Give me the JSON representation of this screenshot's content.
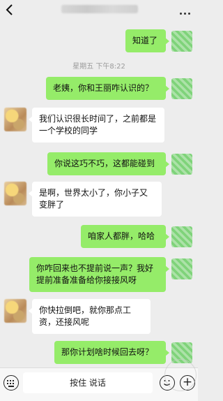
{
  "timestamp": "星期五 下午8:22",
  "messages": [
    {
      "dir": "out",
      "text": "知道了"
    },
    {
      "dir": "out",
      "text": "老姨，你和王丽咋认识的？"
    },
    {
      "dir": "in",
      "text": "我们认识很长时间了，之前都是一个学校的同学"
    },
    {
      "dir": "out",
      "text": "你说这巧不巧，这都能碰到"
    },
    {
      "dir": "in",
      "text": "是啊，世界太小了，你小子又变胖了"
    },
    {
      "dir": "out",
      "text": "咱家人都胖，哈哈"
    },
    {
      "dir": "out",
      "text": "你咋回来也不提前说一声？我好提前准备准备给你接接风呀"
    },
    {
      "dir": "in",
      "text": "你快拉倒吧，就你那点工资，还接风呢"
    },
    {
      "dir": "out",
      "text": "那你计划啥时候回去呀？"
    }
  ],
  "input": {
    "voice_label": "按住 说话"
  },
  "colors": {
    "outgoing_bubble": "#95ec69",
    "incoming_bubble": "#ffffff",
    "background": "#ededed"
  }
}
